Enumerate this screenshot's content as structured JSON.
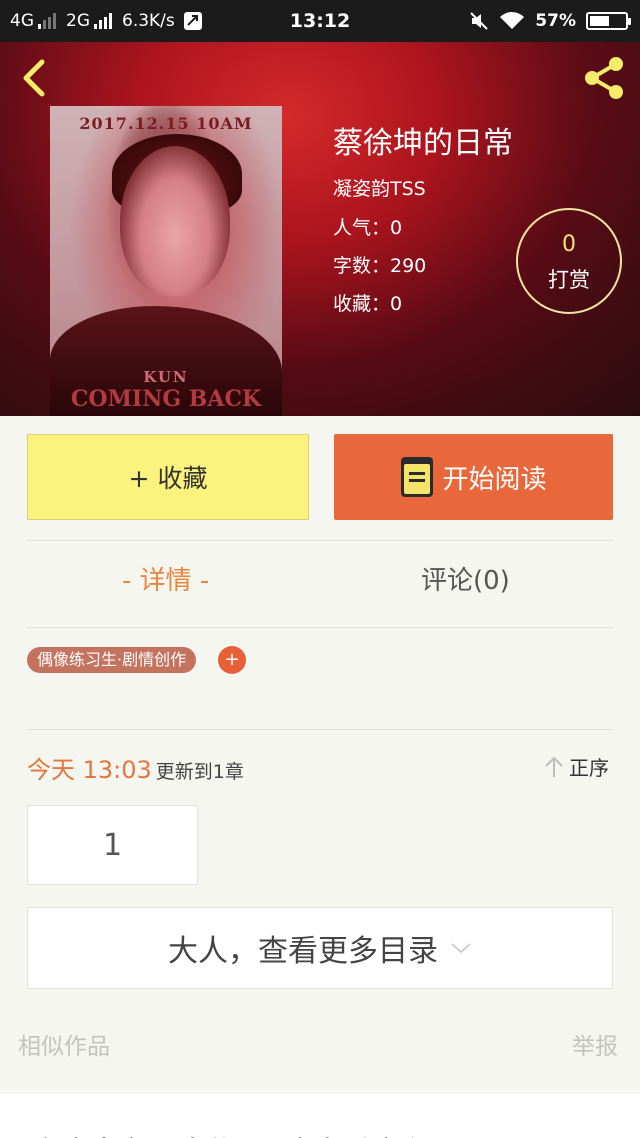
{
  "status_bar": {
    "net1": "4G",
    "net2": "2G",
    "speed": "6.3K/s",
    "time": "13:12",
    "battery": "57%",
    "battery_level": 0.57
  },
  "book": {
    "cover_date": "2017.12.15 10AM",
    "cover_sub": "KUN",
    "cover_text": "COMING BACK",
    "title": "蔡徐坤的日常",
    "author": "凝姿韵TSS",
    "popularity": "人气：0",
    "word_count": "字数：290",
    "favorites": "收藏：0"
  },
  "reward": {
    "count": "0",
    "label": "打赏"
  },
  "actions": {
    "collect": "+ 收藏",
    "read": "开始阅读"
  },
  "tabs": {
    "details": "- 详情 -",
    "comments": "评论(0)"
  },
  "tags": {
    "primary": "偶像练习生·剧情创作",
    "add": "+"
  },
  "update": {
    "today": "今天 13:03",
    "text": "更新到1章",
    "sort": "正序"
  },
  "chapters": {
    "first": "1",
    "more": "大人，查看更多目录"
  },
  "footer": {
    "similar": "相似作品",
    "report": "举报"
  },
  "bottom": {
    "partial_text": "有人当家不啤觉，回来向看这个！"
  }
}
